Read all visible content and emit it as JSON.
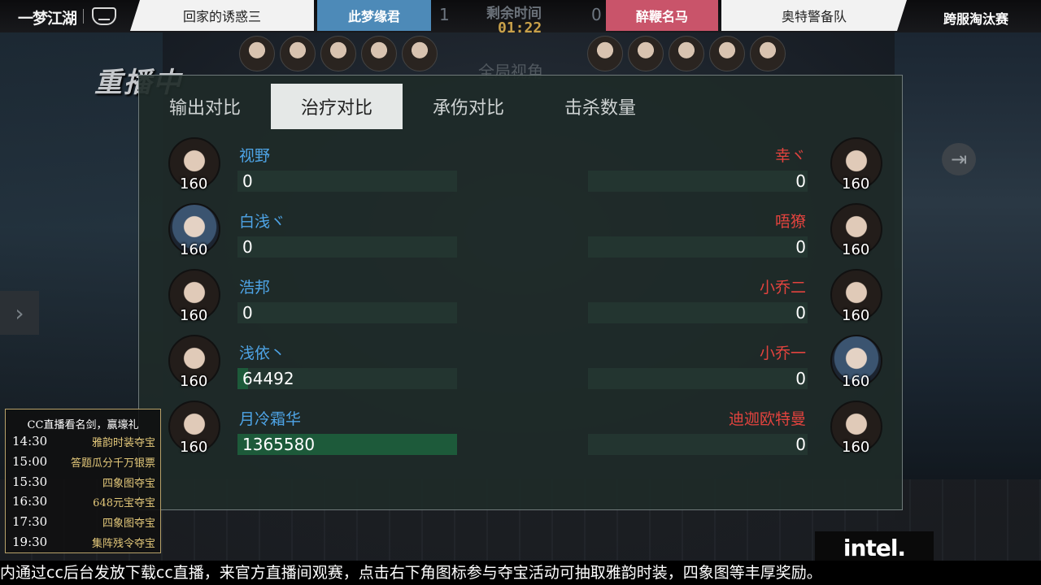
{
  "topbar": {
    "logo_text": "一梦江湖",
    "team_left_outer": "回家的诱惑三",
    "team_left_inner": "此梦缘君",
    "score_left": "1",
    "timer_label": "剩余时间",
    "timer_value": "01:22",
    "score_right": "0",
    "team_right_inner": "醉鞭名马",
    "team_right_outer": "奥特警备队",
    "stage_label": "跨服淘汰赛",
    "colors": {
      "blue_team": "#4d8ab8",
      "red_team": "#c9546a",
      "timer": "#c9a14a"
    }
  },
  "overlay": {
    "replay_label": "重播中",
    "watch_label": "全局视角"
  },
  "tabs": [
    {
      "label": "输出对比",
      "active": false
    },
    {
      "label": "治疗对比",
      "active": true
    },
    {
      "label": "承伤对比",
      "active": false
    },
    {
      "label": "击杀数量",
      "active": false
    }
  ],
  "left_team": [
    {
      "name": "视野",
      "level": "160",
      "value": "0",
      "fill_fraction": 0
    },
    {
      "name": "白浅ヾ",
      "level": "160",
      "value": "0",
      "fill_fraction": 0
    },
    {
      "name": "浩邦",
      "level": "160",
      "value": "0",
      "fill_fraction": 0
    },
    {
      "name": "浅依丶",
      "level": "160",
      "value": "64492",
      "fill_fraction": 0.047
    },
    {
      "name": "月冷霜华",
      "level": "160",
      "value": "1365580",
      "fill_fraction": 1.0
    }
  ],
  "right_team": [
    {
      "name": "幸ヾ",
      "level": "160",
      "value": "0",
      "fill_fraction": 0
    },
    {
      "name": "唔獠",
      "level": "160",
      "value": "0",
      "fill_fraction": 0
    },
    {
      "name": "小乔二",
      "level": "160",
      "value": "0",
      "fill_fraction": 0
    },
    {
      "name": "小乔一",
      "level": "160",
      "value": "0",
      "fill_fraction": 0
    },
    {
      "name": "迪迦欧特曼",
      "level": "160",
      "value": "0",
      "fill_fraction": 0
    }
  ],
  "schedule": {
    "title": "CC直播看名剑，赢壕礼",
    "items": [
      {
        "time": "14:30",
        "event": "雅韵时装夺宝"
      },
      {
        "time": "15:00",
        "event": "答题瓜分千万银票"
      },
      {
        "time": "15:30",
        "event": "四象图夺宝"
      },
      {
        "time": "16:30",
        "event": "648元宝夺宝"
      },
      {
        "time": "17:30",
        "event": "四象图夺宝"
      },
      {
        "time": "19:30",
        "event": "集阵残令夺宝"
      }
    ]
  },
  "sponsor": "intel.",
  "ticker": "内通过cc后台发放下载cc直播，来官方直播间观赛，点击右下角图标参与夺宝活动可抽取雅韵时装，四象图等丰厚奖励。",
  "icons": {
    "left_nav": "chevron-right-icon",
    "right_nav": "exit-icon"
  }
}
